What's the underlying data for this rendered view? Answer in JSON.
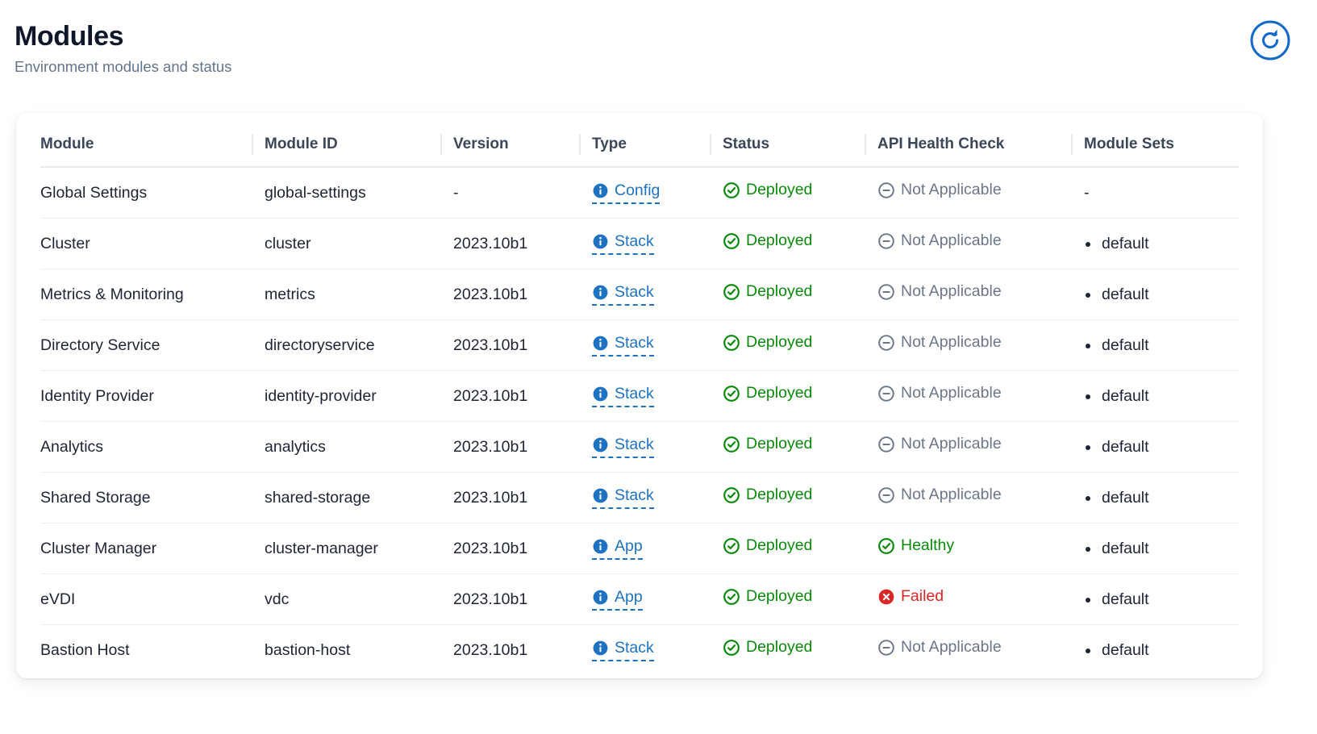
{
  "header": {
    "title": "Modules",
    "subtitle": "Environment modules and status",
    "refresh_icon": "refresh-circle-icon",
    "refresh_label": "Refresh"
  },
  "colors": {
    "accent_blue": "#1d72c2",
    "success_green": "#0a8a0a",
    "error_red": "#dc2626",
    "muted_gray": "#6b7689",
    "title_navy": "#0f172a"
  },
  "table": {
    "columns": [
      "Module",
      "Module ID",
      "Version",
      "Type",
      "Status",
      "API Health Check",
      "Module Sets"
    ],
    "rows": [
      {
        "module": "Global Settings",
        "module_id": "global-settings",
        "version": "-",
        "type": "Config",
        "type_icon": "info-circle-icon",
        "status": "Deployed",
        "status_icon": "check-circle-icon",
        "status_state": "deployed",
        "health": "Not Applicable",
        "health_icon": "minus-circle-icon",
        "health_state": "na",
        "sets": []
      },
      {
        "module": "Cluster",
        "module_id": "cluster",
        "version": "2023.10b1",
        "type": "Stack",
        "type_icon": "info-circle-icon",
        "status": "Deployed",
        "status_icon": "check-circle-icon",
        "status_state": "deployed",
        "health": "Not Applicable",
        "health_icon": "minus-circle-icon",
        "health_state": "na",
        "sets": [
          "default"
        ]
      },
      {
        "module": "Metrics & Monitoring",
        "module_id": "metrics",
        "version": "2023.10b1",
        "type": "Stack",
        "type_icon": "info-circle-icon",
        "status": "Deployed",
        "status_icon": "check-circle-icon",
        "status_state": "deployed",
        "health": "Not Applicable",
        "health_icon": "minus-circle-icon",
        "health_state": "na",
        "sets": [
          "default"
        ]
      },
      {
        "module": "Directory Service",
        "module_id": "directoryservice",
        "version": "2023.10b1",
        "type": "Stack",
        "type_icon": "info-circle-icon",
        "status": "Deployed",
        "status_icon": "check-circle-icon",
        "status_state": "deployed",
        "health": "Not Applicable",
        "health_icon": "minus-circle-icon",
        "health_state": "na",
        "sets": [
          "default"
        ]
      },
      {
        "module": "Identity Provider",
        "module_id": "identity-provider",
        "version": "2023.10b1",
        "type": "Stack",
        "type_icon": "info-circle-icon",
        "status": "Deployed",
        "status_icon": "check-circle-icon",
        "status_state": "deployed",
        "health": "Not Applicable",
        "health_icon": "minus-circle-icon",
        "health_state": "na",
        "sets": [
          "default"
        ]
      },
      {
        "module": "Analytics",
        "module_id": "analytics",
        "version": "2023.10b1",
        "type": "Stack",
        "type_icon": "info-circle-icon",
        "status": "Deployed",
        "status_icon": "check-circle-icon",
        "status_state": "deployed",
        "health": "Not Applicable",
        "health_icon": "minus-circle-icon",
        "health_state": "na",
        "sets": [
          "default"
        ]
      },
      {
        "module": "Shared Storage",
        "module_id": "shared-storage",
        "version": "2023.10b1",
        "type": "Stack",
        "type_icon": "info-circle-icon",
        "status": "Deployed",
        "status_icon": "check-circle-icon",
        "status_state": "deployed",
        "health": "Not Applicable",
        "health_icon": "minus-circle-icon",
        "health_state": "na",
        "sets": [
          "default"
        ]
      },
      {
        "module": "Cluster Manager",
        "module_id": "cluster-manager",
        "version": "2023.10b1",
        "type": "App",
        "type_icon": "info-circle-icon",
        "status": "Deployed",
        "status_icon": "check-circle-icon",
        "status_state": "deployed",
        "health": "Healthy",
        "health_icon": "check-circle-icon",
        "health_state": "healthy",
        "sets": [
          "default"
        ]
      },
      {
        "module": "eVDI",
        "module_id": "vdc",
        "version": "2023.10b1",
        "type": "App",
        "type_icon": "info-circle-icon",
        "status": "Deployed",
        "status_icon": "check-circle-icon",
        "status_state": "deployed",
        "health": "Failed",
        "health_icon": "x-circle-icon",
        "health_state": "failed",
        "sets": [
          "default"
        ]
      },
      {
        "module": "Bastion Host",
        "module_id": "bastion-host",
        "version": "2023.10b1",
        "type": "Stack",
        "type_icon": "info-circle-icon",
        "status": "Deployed",
        "status_icon": "check-circle-icon",
        "status_state": "deployed",
        "health": "Not Applicable",
        "health_icon": "minus-circle-icon",
        "health_state": "na",
        "sets": [
          "default"
        ]
      }
    ],
    "empty_value": "-"
  }
}
